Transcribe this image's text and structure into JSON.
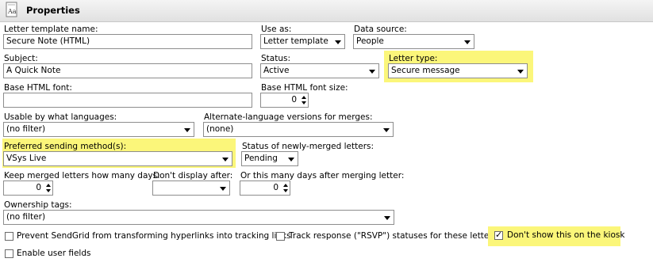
{
  "header": {
    "title": "Properties",
    "icon": "letter-document-icon"
  },
  "fields": {
    "template_name": {
      "label": "Letter template name:",
      "value": "Secure Note (HTML)"
    },
    "use_as": {
      "label": "Use as:",
      "value": "Letter template"
    },
    "data_source": {
      "label": "Data source:",
      "value": "People"
    },
    "subject": {
      "label": "Subject:",
      "value": "A Quick Note"
    },
    "status": {
      "label": "Status:",
      "value": "Active"
    },
    "letter_type": {
      "label": "Letter type:",
      "value": "Secure message"
    },
    "base_font": {
      "label": "Base HTML font:",
      "value": ""
    },
    "base_font_size": {
      "label": "Base HTML font size:",
      "value": "0"
    },
    "languages": {
      "label": "Usable by what languages:",
      "value": "(no filter)"
    },
    "alt_versions": {
      "label": "Alternate-language versions for merges:",
      "value": "(none)"
    },
    "sending_method": {
      "label": "Preferred sending method(s):",
      "value": "VSys Live"
    },
    "merged_status": {
      "label": "Status of newly-merged letters:",
      "value": "Pending"
    },
    "keep_days": {
      "label": "Keep merged letters how many days:",
      "value": "0"
    },
    "dont_display_after": {
      "label": "Don't display after:",
      "value": ""
    },
    "days_after_merge": {
      "label": "Or this many days after merging letter:",
      "value": "0"
    },
    "ownership_tags": {
      "label": "Ownership tags:",
      "value": "(no filter)"
    }
  },
  "checkboxes": {
    "sendgrid": {
      "label": "Prevent SendGrid from transforming hyperlinks into tracking links",
      "checked": false
    },
    "rsvp": {
      "label": "Track response (\"RSVP\") statuses for these letters",
      "checked": false
    },
    "kiosk": {
      "label": "Don't show this on the kiosk",
      "checked": true
    },
    "user_fields": {
      "label": "Enable user fields",
      "checked": false
    }
  },
  "colors": {
    "highlight": "#fbf67a",
    "border": "#8d8d8d"
  }
}
